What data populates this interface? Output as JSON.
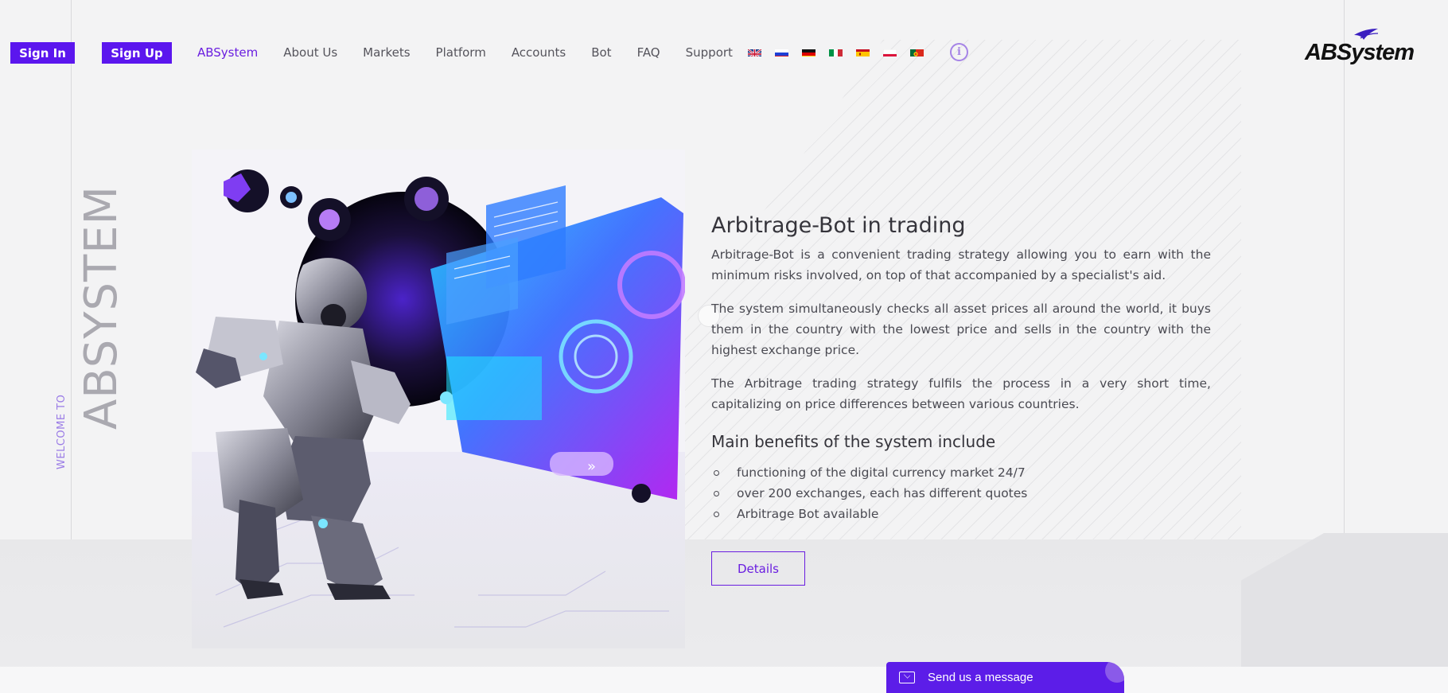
{
  "header": {
    "signin_label": "Sign In",
    "signup_label": "Sign Up",
    "nav": [
      {
        "label": "ABSystem",
        "active": true
      },
      {
        "label": "About Us",
        "active": false
      },
      {
        "label": "Markets",
        "active": false
      },
      {
        "label": "Platform",
        "active": false
      },
      {
        "label": "Accounts",
        "active": false
      },
      {
        "label": "Bot",
        "active": false
      },
      {
        "label": "FAQ",
        "active": false
      },
      {
        "label": "Support",
        "active": false
      }
    ],
    "languages": [
      "gb-flag-icon",
      "ru-flag-icon",
      "de-flag-icon",
      "it-flag-icon",
      "es-flag-icon",
      "pl-flag-icon",
      "pt-flag-icon"
    ],
    "info_icon": "info-icon",
    "logo_text": "ABSystem"
  },
  "side": {
    "title": "ABSYSTEM",
    "welcome": "WELCOME TO"
  },
  "main": {
    "title": "Arbitrage-Bot in trading",
    "paragraphs": [
      "Arbitrage-Bot is a convenient trading strategy allowing you to earn with the minimum risks involved, on top of that accompanied by a specialist's aid.",
      "The system simultaneously checks all asset prices all around the world, it buys them in the country with the lowest price and sells in the country with the highest exchange price.",
      "The Arbitrage trading strategy fulfils the process in a very short time, capitalizing on price differences between various countries."
    ],
    "benefits_title": "Main benefits of the system include",
    "benefits": [
      "functioning of the digital currency market 24/7",
      "over 200 exchanges, each has different quotes",
      "Arbitrage Bot available"
    ],
    "details_label": "Details"
  },
  "chat": {
    "label": "Send us a message"
  },
  "colors": {
    "accent": "#5b16ee",
    "accent_text": "#6a1ee0",
    "background": "#f3f3f4"
  }
}
